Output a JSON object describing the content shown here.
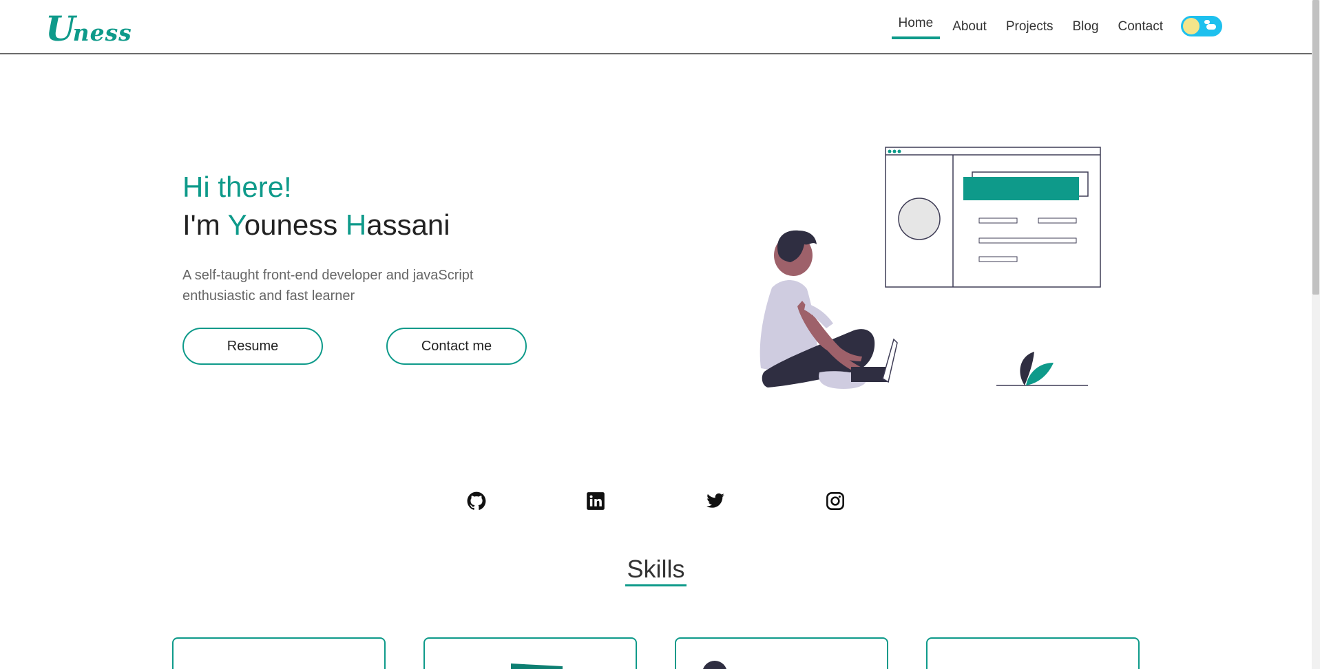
{
  "brand": {
    "logo_big": "U",
    "logo_small": "ness"
  },
  "nav": {
    "items": [
      {
        "label": "Home",
        "active": true
      },
      {
        "label": "About"
      },
      {
        "label": "Projects"
      },
      {
        "label": "Blog"
      },
      {
        "label": "Contact"
      }
    ],
    "theme_toggle": "light-mode"
  },
  "hero": {
    "greeting": "Hi there!",
    "name_prefix": "I'm ",
    "first_initial": "Y",
    "first_rest": "ouness ",
    "last_initial": "H",
    "last_rest": "assani",
    "description": "A self-taught front-end developer and javaScript enthusiastic and fast learner",
    "resume_label": "Resume",
    "contact_label": "Contact me"
  },
  "socials": [
    "github-icon",
    "linkedin-icon",
    "twitter-icon",
    "instagram-icon"
  ],
  "skills": {
    "title": "Skills"
  },
  "colors": {
    "accent": "#0e9a8a",
    "toggle": "#1ec0ee",
    "sun": "#f4e58a"
  }
}
